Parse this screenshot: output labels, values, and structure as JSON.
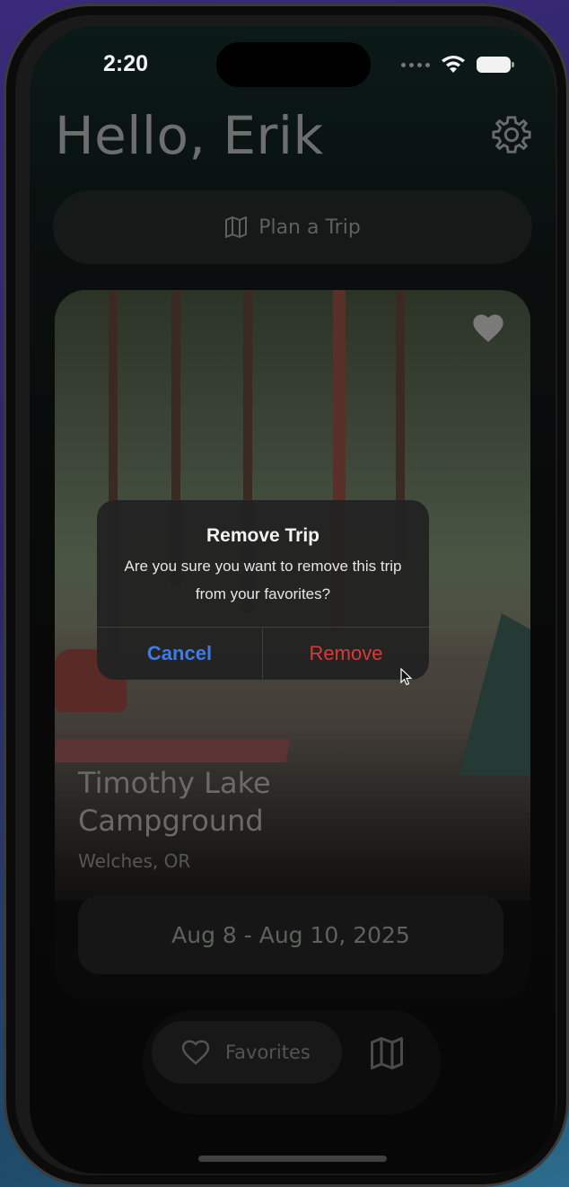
{
  "status_bar": {
    "time": "2:20"
  },
  "header": {
    "greeting": "Hello, Erik"
  },
  "plan_trip": {
    "label": "Plan a Trip"
  },
  "trip_card": {
    "title": "Timothy Lake Campground",
    "location": "Welches, OR",
    "dates": "Aug 8 - Aug 10, 2025",
    "favorited": true
  },
  "alert": {
    "title": "Remove Trip",
    "message": "Are you sure you want to remove this trip from your favorites?",
    "cancel_label": "Cancel",
    "remove_label": "Remove"
  },
  "tab_bar": {
    "favorites_label": "Favorites"
  },
  "colors": {
    "cancel": "#3f7be6",
    "remove": "#d93a3a"
  },
  "icons": [
    "gear-icon",
    "map-icon",
    "heart-icon",
    "wifi-icon",
    "battery-icon"
  ]
}
